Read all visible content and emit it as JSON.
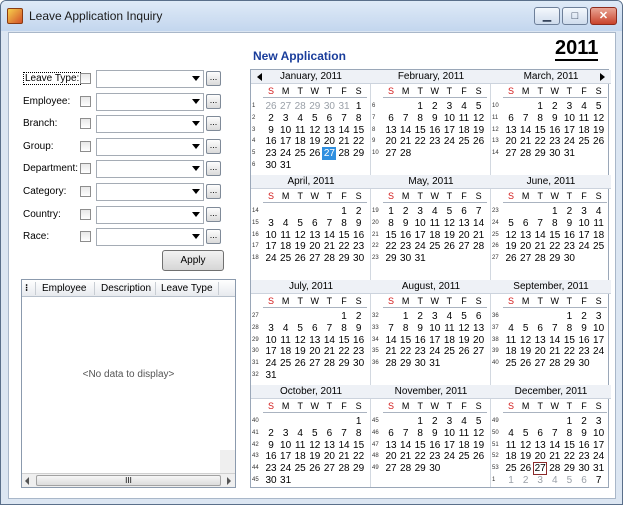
{
  "window": {
    "title": "Leave Application Inquiry"
  },
  "header": {
    "new_application": "New Application",
    "year": "2011"
  },
  "filters": [
    {
      "label": "Leave Type:",
      "value": ""
    },
    {
      "label": "Employee:",
      "value": ""
    },
    {
      "label": "Branch:",
      "value": ""
    },
    {
      "label": "Group:",
      "value": ""
    },
    {
      "label": "Department:",
      "value": ""
    },
    {
      "label": "Category:",
      "value": ""
    },
    {
      "label": "Country:",
      "value": ""
    },
    {
      "label": "Race:",
      "value": ""
    }
  ],
  "ellipsis": "...",
  "apply_label": "Apply",
  "grid": {
    "columns": [
      "Employee",
      "Description",
      "Leave Type"
    ],
    "empty": "<No data to display>",
    "scroll_thumb": "III"
  },
  "calendar": {
    "weekdays": [
      "S",
      "M",
      "T",
      "W",
      "T",
      "F",
      "S"
    ],
    "today": {
      "month": 0,
      "day": 27
    },
    "boxed": {
      "month": 11,
      "day": 27
    },
    "months": [
      {
        "name": "January, 2011",
        "weeks": [
          "1",
          "2",
          "3",
          "4",
          "5",
          "6"
        ],
        "rows": [
          [
            "26",
            "27",
            "28",
            "29",
            "30",
            "31",
            "1"
          ],
          [
            "2",
            "3",
            "4",
            "5",
            "6",
            "7",
            "8"
          ],
          [
            "9",
            "10",
            "11",
            "12",
            "13",
            "14",
            "15"
          ],
          [
            "16",
            "17",
            "18",
            "19",
            "20",
            "21",
            "22"
          ],
          [
            "23",
            "24",
            "25",
            "26",
            "27",
            "28",
            "29"
          ],
          [
            "30",
            "31",
            "",
            "",
            "",
            "",
            ""
          ]
        ]
      },
      {
        "name": "February, 2011",
        "weeks": [
          "6",
          "7",
          "8",
          "9",
          "10"
        ],
        "rows": [
          [
            "",
            "",
            "1",
            "2",
            "3",
            "4",
            "5"
          ],
          [
            "6",
            "7",
            "8",
            "9",
            "10",
            "11",
            "12"
          ],
          [
            "13",
            "14",
            "15",
            "16",
            "17",
            "18",
            "19"
          ],
          [
            "20",
            "21",
            "22",
            "23",
            "24",
            "25",
            "26"
          ],
          [
            "27",
            "28",
            "",
            "",
            "",
            "",
            ""
          ]
        ]
      },
      {
        "name": "March, 2011",
        "weeks": [
          "10",
          "11",
          "12",
          "13",
          "14"
        ],
        "rows": [
          [
            "",
            "",
            "1",
            "2",
            "3",
            "4",
            "5"
          ],
          [
            "6",
            "7",
            "8",
            "9",
            "10",
            "11",
            "12"
          ],
          [
            "13",
            "14",
            "15",
            "16",
            "17",
            "18",
            "19"
          ],
          [
            "20",
            "21",
            "22",
            "23",
            "24",
            "25",
            "26"
          ],
          [
            "27",
            "28",
            "29",
            "30",
            "31",
            "",
            ""
          ]
        ]
      },
      {
        "name": "April, 2011",
        "weeks": [
          "14",
          "15",
          "16",
          "17",
          "18"
        ],
        "rows": [
          [
            "",
            "",
            "",
            "",
            "",
            "1",
            "2"
          ],
          [
            "3",
            "4",
            "5",
            "6",
            "7",
            "8",
            "9"
          ],
          [
            "10",
            "11",
            "12",
            "13",
            "14",
            "15",
            "16"
          ],
          [
            "17",
            "18",
            "19",
            "20",
            "21",
            "22",
            "23"
          ],
          [
            "24",
            "25",
            "26",
            "27",
            "28",
            "29",
            "30"
          ]
        ]
      },
      {
        "name": "May, 2011",
        "weeks": [
          "19",
          "20",
          "21",
          "22",
          "23"
        ],
        "rows": [
          [
            "1",
            "2",
            "3",
            "4",
            "5",
            "6",
            "7"
          ],
          [
            "8",
            "9",
            "10",
            "11",
            "12",
            "13",
            "14"
          ],
          [
            "15",
            "16",
            "17",
            "18",
            "19",
            "20",
            "21"
          ],
          [
            "22",
            "23",
            "24",
            "25",
            "26",
            "27",
            "28"
          ],
          [
            "29",
            "30",
            "31",
            "",
            "",
            "",
            ""
          ]
        ]
      },
      {
        "name": "June, 2011",
        "weeks": [
          "23",
          "24",
          "25",
          "26",
          "27"
        ],
        "rows": [
          [
            "",
            "",
            "",
            "1",
            "2",
            "3",
            "4"
          ],
          [
            "5",
            "6",
            "7",
            "8",
            "9",
            "10",
            "11"
          ],
          [
            "12",
            "13",
            "14",
            "15",
            "16",
            "17",
            "18"
          ],
          [
            "19",
            "20",
            "21",
            "22",
            "23",
            "24",
            "25"
          ],
          [
            "26",
            "27",
            "28",
            "29",
            "30",
            "",
            ""
          ]
        ]
      },
      {
        "name": "July, 2011",
        "weeks": [
          "27",
          "28",
          "29",
          "30",
          "31",
          "32"
        ],
        "rows": [
          [
            "",
            "",
            "",
            "",
            "",
            "1",
            "2"
          ],
          [
            "3",
            "4",
            "5",
            "6",
            "7",
            "8",
            "9"
          ],
          [
            "10",
            "11",
            "12",
            "13",
            "14",
            "15",
            "16"
          ],
          [
            "17",
            "18",
            "19",
            "20",
            "21",
            "22",
            "23"
          ],
          [
            "24",
            "25",
            "26",
            "27",
            "28",
            "29",
            "30"
          ],
          [
            "31",
            "",
            "",
            "",
            "",
            "",
            ""
          ]
        ]
      },
      {
        "name": "August, 2011",
        "weeks": [
          "32",
          "33",
          "34",
          "35",
          "36"
        ],
        "rows": [
          [
            "",
            "1",
            "2",
            "3",
            "4",
            "5",
            "6"
          ],
          [
            "7",
            "8",
            "9",
            "10",
            "11",
            "12",
            "13"
          ],
          [
            "14",
            "15",
            "16",
            "17",
            "18",
            "19",
            "20"
          ],
          [
            "21",
            "22",
            "23",
            "24",
            "25",
            "26",
            "27"
          ],
          [
            "28",
            "29",
            "30",
            "31",
            "",
            "",
            ""
          ]
        ]
      },
      {
        "name": "September, 2011",
        "weeks": [
          "36",
          "37",
          "38",
          "39",
          "40"
        ],
        "rows": [
          [
            "",
            "",
            "",
            "",
            "1",
            "2",
            "3"
          ],
          [
            "4",
            "5",
            "6",
            "7",
            "8",
            "9",
            "10"
          ],
          [
            "11",
            "12",
            "13",
            "14",
            "15",
            "16",
            "17"
          ],
          [
            "18",
            "19",
            "20",
            "21",
            "22",
            "23",
            "24"
          ],
          [
            "25",
            "26",
            "27",
            "28",
            "29",
            "30",
            ""
          ]
        ]
      },
      {
        "name": "October, 2011",
        "weeks": [
          "40",
          "41",
          "42",
          "43",
          "44",
          "45"
        ],
        "rows": [
          [
            "",
            "",
            "",
            "",
            "",
            "",
            "1"
          ],
          [
            "2",
            "3",
            "4",
            "5",
            "6",
            "7",
            "8"
          ],
          [
            "9",
            "10",
            "11",
            "12",
            "13",
            "14",
            "15"
          ],
          [
            "16",
            "17",
            "18",
            "19",
            "20",
            "21",
            "22"
          ],
          [
            "23",
            "24",
            "25",
            "26",
            "27",
            "28",
            "29"
          ],
          [
            "30",
            "31",
            "",
            "",
            "",
            "",
            ""
          ]
        ]
      },
      {
        "name": "November, 2011",
        "weeks": [
          "45",
          "46",
          "47",
          "48",
          "49"
        ],
        "rows": [
          [
            "",
            "",
            "1",
            "2",
            "3",
            "4",
            "5"
          ],
          [
            "6",
            "7",
            "8",
            "9",
            "10",
            "11",
            "12"
          ],
          [
            "13",
            "14",
            "15",
            "16",
            "17",
            "18",
            "19"
          ],
          [
            "20",
            "21",
            "22",
            "23",
            "24",
            "25",
            "26"
          ],
          [
            "27",
            "28",
            "29",
            "30",
            "",
            "",
            ""
          ]
        ]
      },
      {
        "name": "December, 2011",
        "weeks": [
          "49",
          "50",
          "51",
          "52",
          "53",
          "1"
        ],
        "rows": [
          [
            "",
            "",
            "",
            "",
            "1",
            "2",
            "3"
          ],
          [
            "4",
            "5",
            "6",
            "7",
            "8",
            "9",
            "10"
          ],
          [
            "11",
            "12",
            "13",
            "14",
            "15",
            "16",
            "17"
          ],
          [
            "18",
            "19",
            "20",
            "21",
            "22",
            "23",
            "24"
          ],
          [
            "25",
            "26",
            "27",
            "28",
            "29",
            "30",
            "31"
          ],
          [
            "1",
            "2",
            "3",
            "4",
            "5",
            "6",
            "7"
          ]
        ]
      }
    ]
  }
}
